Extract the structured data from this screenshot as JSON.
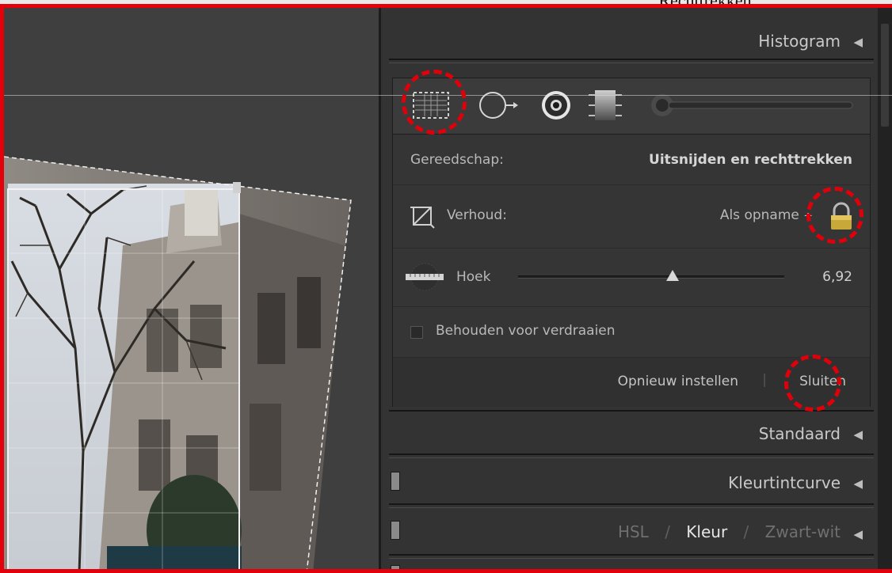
{
  "caption": "Rechttrekken",
  "panel": {
    "histogram_title": "Histogram",
    "crop": {
      "tool_label": "Gereedschap:",
      "tool_value": "Uitsnijden en rechttrekken",
      "aspect_label": "Verhoud:",
      "aspect_value": "Als opname",
      "aspect_arrow": "÷",
      "angle_label": "Hoek",
      "angle_value": "6,92",
      "angle_fraction": 0.58,
      "constrain_label": "Behouden voor verdraaien",
      "reset_label": "Opnieuw instellen",
      "separator": "|",
      "close_label": "Sluiten"
    },
    "sections": {
      "basic": "Standaard",
      "tone_curve": "Kleurtintcurve",
      "hsl": "HSL",
      "slash1": "/",
      "color": "Kleur",
      "slash2": "/",
      "bw": "Zwart-wit"
    },
    "tools": [
      "crop-icon",
      "spot-removal-icon",
      "red-eye-icon",
      "graduated-filter-icon",
      "adjustment-brush-icon"
    ]
  },
  "colors": {
    "highlight": "#e0000a",
    "panel_bg": "#333333",
    "text": "#c9c9c9"
  }
}
